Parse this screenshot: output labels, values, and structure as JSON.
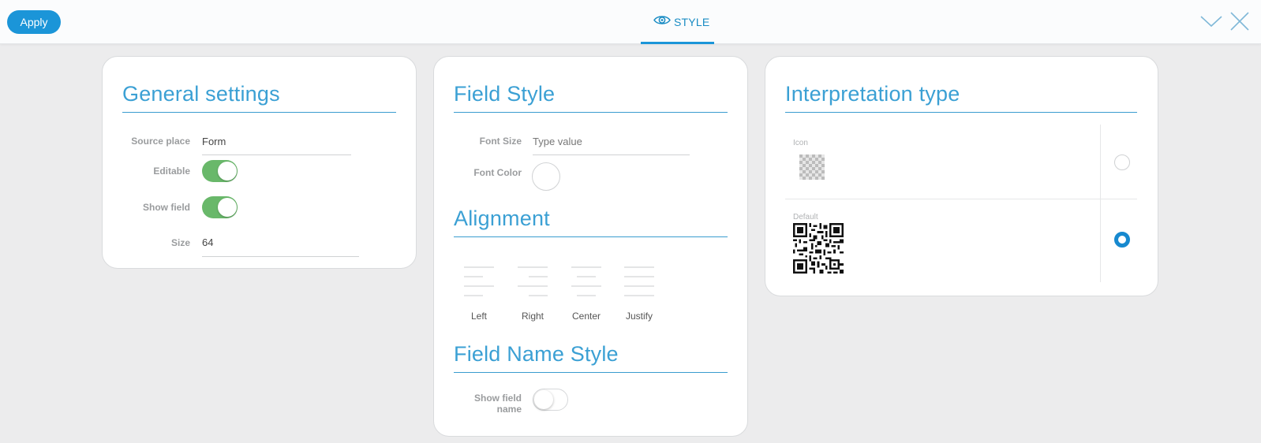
{
  "toolbar": {
    "apply_label": "Apply",
    "tab_label": "STYLE",
    "tab_icon": "eye-icon",
    "collapse_icon": "chevron-down-icon",
    "close_icon": "close-icon"
  },
  "general_settings": {
    "title": "General settings",
    "source_place": {
      "label": "Source place",
      "value": "Form"
    },
    "editable": {
      "label": "Editable",
      "on": true
    },
    "show_field": {
      "label": "Show field",
      "on": true
    },
    "size": {
      "label": "Size",
      "value": "64"
    }
  },
  "field_style": {
    "title": "Field Style",
    "font_size": {
      "label": "Font Size",
      "placeholder": "Type value"
    },
    "font_color": {
      "label": "Font Color"
    },
    "alignment": {
      "title": "Alignment",
      "options": [
        {
          "label": "Left",
          "icon": "align-left-icon"
        },
        {
          "label": "Right",
          "icon": "align-right-icon"
        },
        {
          "label": "Center",
          "icon": "align-center-icon"
        },
        {
          "label": "Justify",
          "icon": "align-justify-icon"
        }
      ]
    },
    "field_name_style": {
      "title": "Field Name Style",
      "show_field_name": {
        "label_line1": "Show field",
        "label_line2": "name",
        "on": false
      }
    }
  },
  "interpretation_type": {
    "title": "Interpretation type",
    "options": [
      {
        "label": "Icon",
        "selected": false,
        "preview": "checkerboard-icon"
      },
      {
        "label": "Default",
        "selected": true,
        "preview": "qr-code-icon"
      }
    ]
  },
  "colors": {
    "accent": "#1b95d8",
    "toggle_on": "#69b86a",
    "title_blue": "#3ba0d4"
  }
}
